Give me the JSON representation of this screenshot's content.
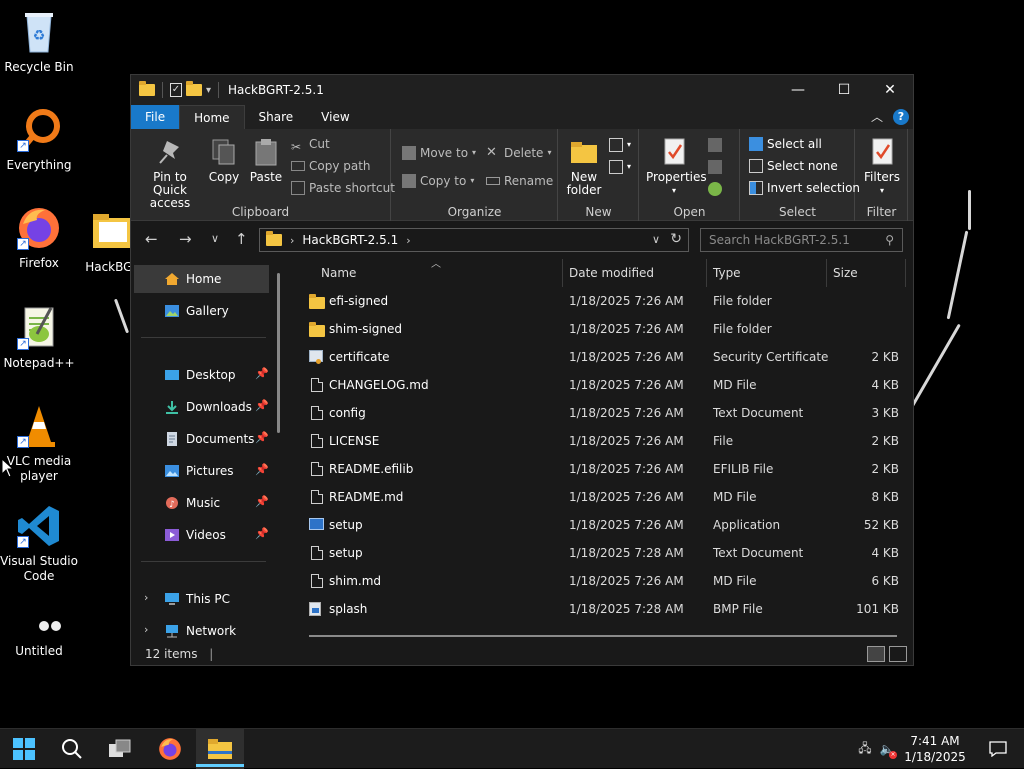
{
  "desktop": {
    "icons": [
      {
        "label": "Recycle Bin"
      },
      {
        "label": "Everything"
      },
      {
        "label": "Firefox"
      },
      {
        "label": "Notepad++"
      },
      {
        "label": "VLC media player"
      },
      {
        "label": "Visual Studio Code"
      },
      {
        "label": "Untitled"
      },
      {
        "label": "HackBGR"
      }
    ]
  },
  "window": {
    "title": "HackBGRT-2.5.1",
    "controls": {
      "minimize": "—",
      "maximize": "☐",
      "close": "✕"
    },
    "tabs": {
      "file": "File",
      "home": "Home",
      "share": "Share",
      "view": "View"
    },
    "help": "?"
  },
  "ribbon": {
    "clipboard": {
      "label": "Clipboard",
      "pin": "Pin to Quick access",
      "copy": "Copy",
      "paste": "Paste",
      "cut": "Cut",
      "copy_path": "Copy path",
      "paste_shortcut": "Paste shortcut"
    },
    "organize": {
      "label": "Organize",
      "move_to": "Move to",
      "copy_to": "Copy to",
      "delete": "Delete",
      "rename": "Rename"
    },
    "new": {
      "label": "New",
      "new_folder": "New folder"
    },
    "open": {
      "label": "Open",
      "properties": "Properties"
    },
    "select": {
      "label": "Select",
      "select_all": "Select all",
      "select_none": "Select none",
      "invert_selection": "Invert selection"
    },
    "filter": {
      "label": "Filter",
      "filters": "Filters"
    }
  },
  "address": {
    "path": "HackBGRT-2.5.1",
    "search_placeholder": "Search HackBGRT-2.5.1"
  },
  "nav": {
    "home": "Home",
    "gallery": "Gallery",
    "desktop": "Desktop",
    "downloads": "Downloads",
    "documents": "Documents",
    "pictures": "Pictures",
    "music": "Music",
    "videos": "Videos",
    "this_pc": "This PC",
    "network": "Network"
  },
  "columns": {
    "name": "Name",
    "date": "Date modified",
    "type": "Type",
    "size": "Size"
  },
  "files": [
    {
      "name": "efi-signed",
      "date": "1/18/2025 7:26 AM",
      "type": "File folder",
      "size": ""
    },
    {
      "name": "shim-signed",
      "date": "1/18/2025 7:26 AM",
      "type": "File folder",
      "size": ""
    },
    {
      "name": "certificate",
      "date": "1/18/2025 7:26 AM",
      "type": "Security Certificate",
      "size": "2 KB"
    },
    {
      "name": "CHANGELOG.md",
      "date": "1/18/2025 7:26 AM",
      "type": "MD File",
      "size": "4 KB"
    },
    {
      "name": "config",
      "date": "1/18/2025 7:26 AM",
      "type": "Text Document",
      "size": "3 KB"
    },
    {
      "name": "LICENSE",
      "date": "1/18/2025 7:26 AM",
      "type": "File",
      "size": "2 KB"
    },
    {
      "name": "README.efilib",
      "date": "1/18/2025 7:26 AM",
      "type": "EFILIB File",
      "size": "2 KB"
    },
    {
      "name": "README.md",
      "date": "1/18/2025 7:26 AM",
      "type": "MD File",
      "size": "8 KB"
    },
    {
      "name": "setup",
      "date": "1/18/2025 7:26 AM",
      "type": "Application",
      "size": "52 KB"
    },
    {
      "name": "setup",
      "date": "1/18/2025 7:28 AM",
      "type": "Text Document",
      "size": "4 KB"
    },
    {
      "name": "shim.md",
      "date": "1/18/2025 7:26 AM",
      "type": "MD File",
      "size": "6 KB"
    },
    {
      "name": "splash",
      "date": "1/18/2025 7:28 AM",
      "type": "BMP File",
      "size": "101 KB"
    }
  ],
  "status": {
    "items": "12 items"
  },
  "taskbar": {
    "time": "7:41 AM",
    "date": "1/18/2025"
  }
}
